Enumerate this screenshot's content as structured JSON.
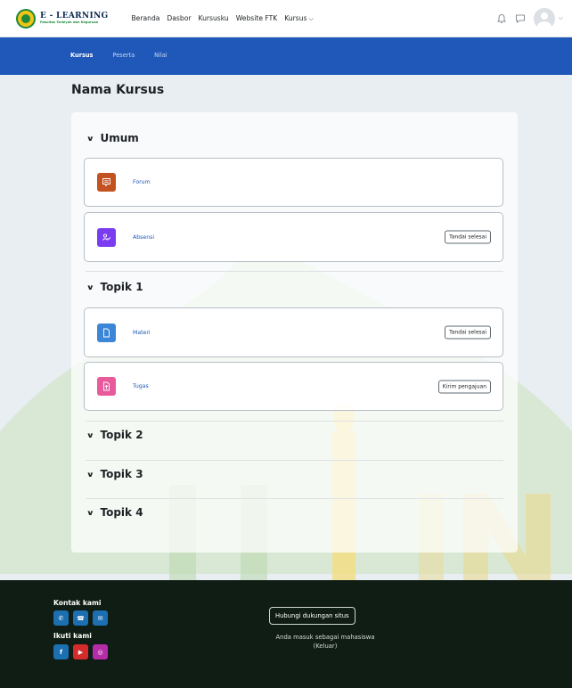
{
  "brand": {
    "title": "E - LEARNING",
    "subtitle": "Fakultas Tarbiyah dan Keguruan"
  },
  "primary_nav": [
    "Beranda",
    "Dasbor",
    "Kursusku",
    "Website FTK",
    "Kursus"
  ],
  "secondary_nav": {
    "tabs": [
      "Kursus",
      "Peserta",
      "Nilai"
    ],
    "active": "Kursus"
  },
  "page": {
    "title": "Nama Kursus"
  },
  "sections": [
    {
      "title": "Umum",
      "expanded": true,
      "activities": [
        {
          "name": "Forum",
          "icon": "forum-icon",
          "color": "#c2521f",
          "button": ""
        },
        {
          "name": "Absensi",
          "icon": "attendance-icon",
          "color": "#7a3cf0",
          "button": "Tandai selesai"
        }
      ]
    },
    {
      "title": "Topik 1",
      "expanded": true,
      "activities": [
        {
          "name": "Materi",
          "icon": "file-icon",
          "color": "#3b86d6",
          "button": "Tandai selesai"
        },
        {
          "name": "Tugas",
          "icon": "assignment-icon",
          "color": "#e85a9c",
          "button": "Kirim pengajuan"
        }
      ]
    },
    {
      "title": "Topik 2",
      "expanded": false
    },
    {
      "title": "Topik 3",
      "expanded": false
    },
    {
      "title": "Topik 4",
      "expanded": false
    }
  ],
  "footer": {
    "contact_heading": "Kontak kami",
    "contact_icons": [
      {
        "icon": "whatsapp-icon",
        "color": "#1c6fb0"
      },
      {
        "icon": "phone-icon",
        "color": "#1c6fb0"
      },
      {
        "icon": "email-icon",
        "color": "#1c6fb0"
      }
    ],
    "follow_heading": "Ikuti kami",
    "follow_icons": [
      {
        "icon": "facebook-icon",
        "color": "#1c6fb0"
      },
      {
        "icon": "youtube-icon",
        "color": "#d42b2b"
      },
      {
        "icon": "instagram-icon",
        "color": "#b52ca8"
      }
    ],
    "support_button": "Hubungi dukungan situs",
    "login_info": "Anda masuk sebagai mahasiswa",
    "logout_link": "(Keluar)"
  }
}
